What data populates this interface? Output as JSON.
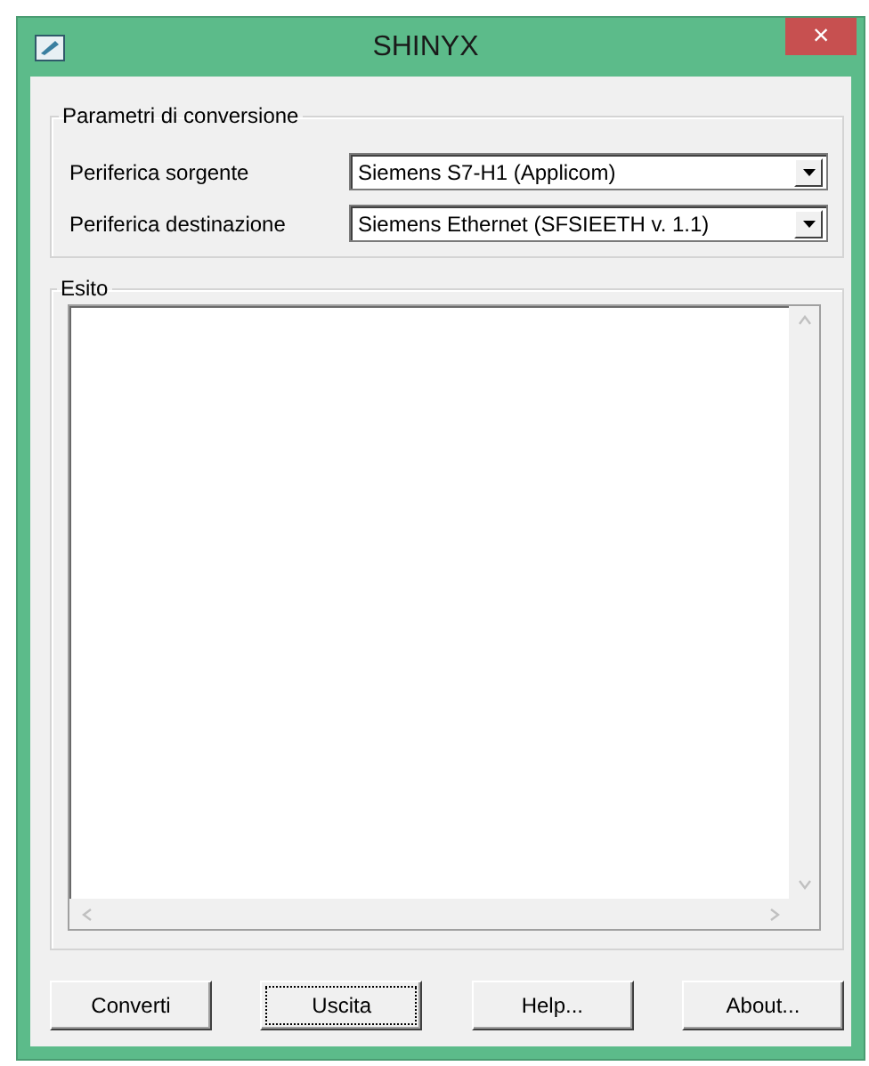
{
  "window": {
    "title": "SHINYX",
    "close": "×"
  },
  "conversion_group": {
    "legend": "Parametri di conversione",
    "fields": [
      {
        "label": "Periferica sorgente",
        "value": "Siemens S7-H1  (Applicom)"
      },
      {
        "label": "Periferica destinazione",
        "value": "Siemens Ethernet (SFSIEETH v. 1.1)"
      }
    ]
  },
  "result_group": {
    "legend": "Esito"
  },
  "buttons": [
    {
      "label": "Converti",
      "focused": false
    },
    {
      "label": "Uscita",
      "focused": true
    },
    {
      "label": "Help...",
      "focused": false
    },
    {
      "label": "About...",
      "focused": false
    }
  ]
}
